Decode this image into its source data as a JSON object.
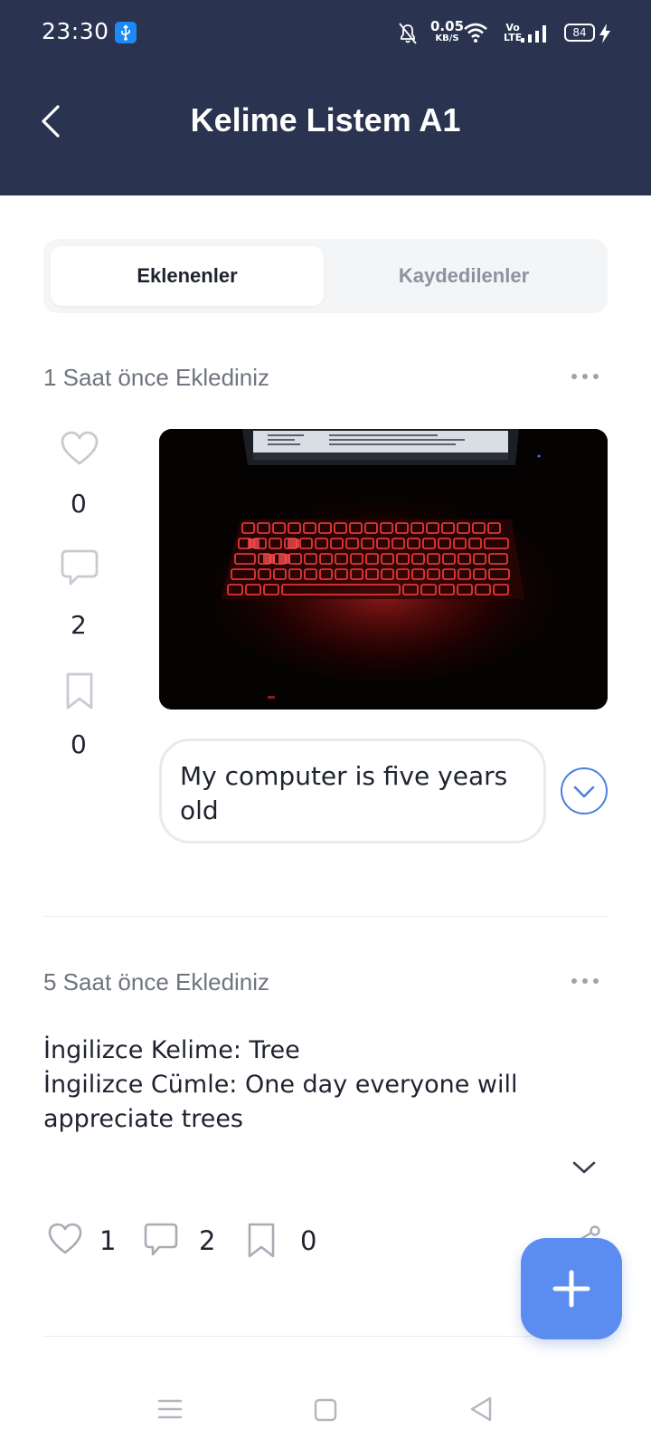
{
  "status_bar": {
    "time": "23:30",
    "net_speed_value": "0.05",
    "net_speed_unit": "KB/S",
    "volte_top": "Vo",
    "volte_bottom": "LTE",
    "battery": "84",
    "icons": [
      "usb-icon",
      "mute-icon",
      "wifi-icon",
      "signal-icon",
      "battery-icon",
      "charging-icon"
    ]
  },
  "header": {
    "title": "Kelime Listem A1",
    "back_icon": "chevron-left-icon",
    "background": "#2a3350"
  },
  "tabs": [
    {
      "label": "Eklenenler",
      "active": true
    },
    {
      "label": "Kaydedilenler",
      "active": false
    }
  ],
  "posts": [
    {
      "time": "1 Saat önce Eklediniz",
      "likes": "0",
      "comments": "2",
      "saves": "0",
      "image": "laptop-red-backlit-keyboard-photo",
      "sentence": "My computer is five years old"
    },
    {
      "time": "5 Saat önce Eklediniz",
      "lines": [
        "İngilizce Kelime: Tree",
        "İngilizce Cümle: One day everyone will appreciate trees"
      ],
      "likes": "1",
      "comments": "2",
      "saves": "0"
    }
  ],
  "fab": {
    "icon": "plus-icon",
    "color": "#5b8df0"
  },
  "nav": {
    "icons": [
      "menu-icon",
      "home-square-icon",
      "back-triangle-icon"
    ]
  },
  "colors": {
    "accent": "#5b8df0",
    "text": "#1f2330",
    "muted": "#6f7480"
  }
}
